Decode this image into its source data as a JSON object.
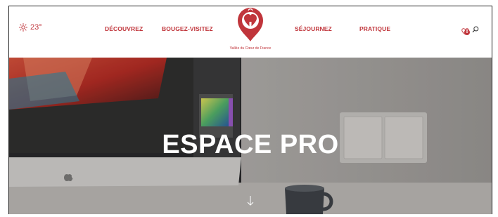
{
  "header": {
    "weather": {
      "icon": "sun-icon",
      "temperature": "23°"
    },
    "nav": [
      {
        "label": "DÉCOUVREZ"
      },
      {
        "label": "BOUGEZ-VISITEZ"
      },
      {
        "label": "SÉJOURNEZ"
      },
      {
        "label": "PRATIQUE"
      }
    ],
    "logo": {
      "icon": "heart-pin-logo",
      "caption": "Vallée du Cœur de France"
    },
    "tools": {
      "favorites_count": "0",
      "favorites_icon": "heart-icon",
      "search_icon": "search-icon"
    }
  },
  "hero": {
    "title": "ESPACE PRO",
    "scroll_icon": "arrow-down-icon"
  },
  "colors": {
    "brand": "#c0353b",
    "hero_text": "#ffffff"
  }
}
